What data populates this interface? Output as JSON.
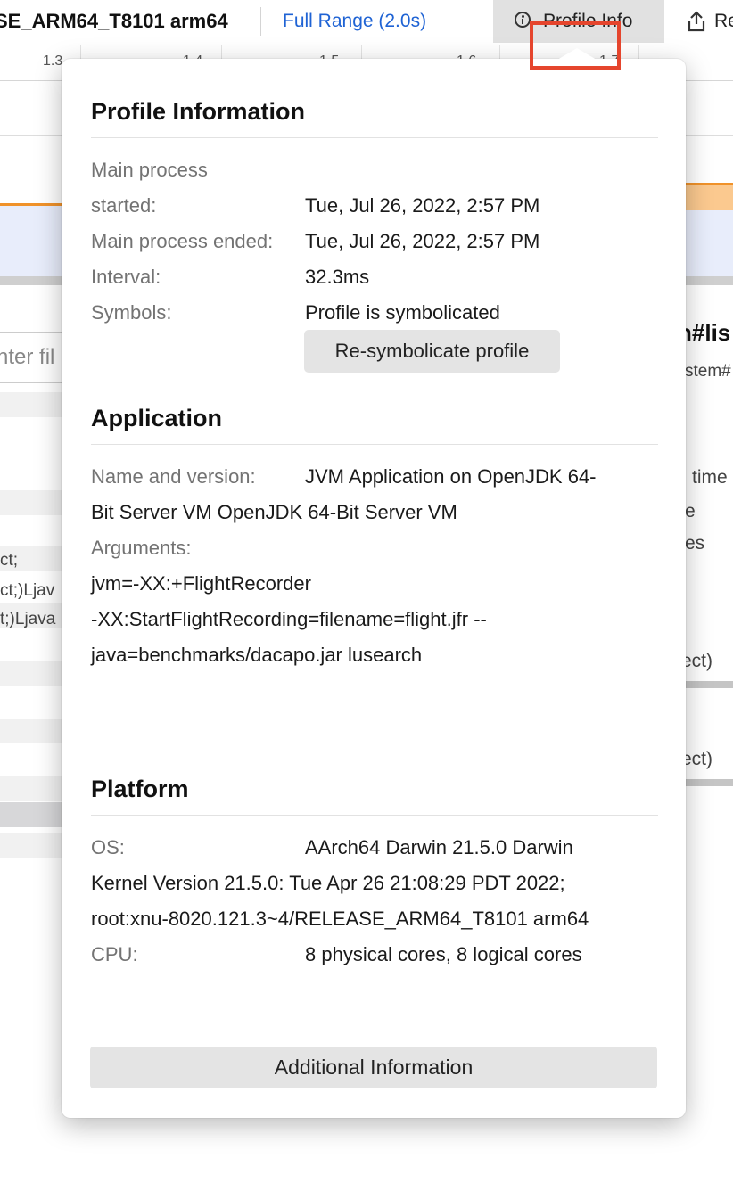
{
  "topbar": {
    "platform_title": "SE_ARM64_T8101 arm64",
    "full_range": "Full Range (2.0s)",
    "profile_info_label": "Profile Info",
    "upload_label": "Re"
  },
  "ruler": {
    "ticks": [
      "1.3",
      "1.4",
      "1.5",
      "1.6",
      "1.7"
    ]
  },
  "left_panel": {
    "filter_placeholder": "nter fil",
    "row_texts": [
      "ct;",
      "ct;)Ljav",
      "t;)Ljava"
    ]
  },
  "right_panel": {
    "texts": [
      "n#lis",
      "stem#",
      "time",
      "e",
      "es",
      "ect)",
      "ect)"
    ]
  },
  "popover": {
    "profile_information": {
      "title": "Profile Information",
      "main_process_started_label_1": "Main process",
      "main_process_started_label_2": "started:",
      "main_process_started_value": "Tue, Jul 26, 2022, 2:57 PM",
      "main_process_ended_label": "Main process ended:",
      "main_process_ended_value": "Tue, Jul 26, 2022, 2:57 PM",
      "interval_label": "Interval:",
      "interval_value": "32.3ms",
      "symbols_label": "Symbols:",
      "symbols_value": "Profile is symbolicated",
      "resymbolicate_button": "Re-symbolicate profile"
    },
    "application": {
      "title": "Application",
      "name_version_label": "Name and version:",
      "name_version_value_1": "JVM Application on OpenJDK 64-",
      "name_version_value_2": "Bit Server VM OpenJDK 64-Bit Server VM",
      "arguments_label": "Arguments:",
      "arguments_line_1": "jvm=-XX:+FlightRecorder",
      "arguments_line_2": "-XX:StartFlightRecording=filename=flight.jfr --",
      "arguments_line_3": "java=benchmarks/dacapo.jar lusearch"
    },
    "platform": {
      "title": "Platform",
      "os_label": "OS:",
      "os_value_1": "AArch64 Darwin 21.5.0 Darwin",
      "os_value_2": "Kernel Version 21.5.0: Tue Apr 26 21:08:29 PDT 2022;",
      "os_value_3": "root:xnu-8020.121.3~4/RELEASE_ARM64_T8101 arm64",
      "cpu_label": "CPU:",
      "cpu_value": "8 physical cores, 8 logical cores"
    },
    "additional_button": "Additional Information"
  },
  "colors": {
    "accent": "#1f63d4",
    "highlight": "#e5452d",
    "graph_line": "#f0922a"
  }
}
